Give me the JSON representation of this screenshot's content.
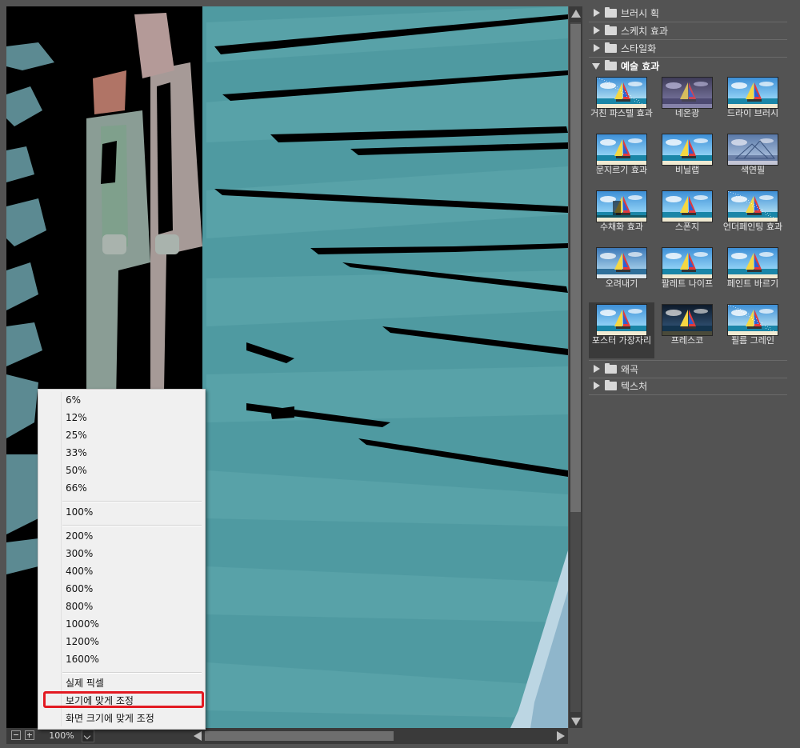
{
  "zoom_menu": {
    "items": [
      "6%",
      "12%",
      "25%",
      "33%",
      "50%",
      "66%",
      "100%",
      "200%",
      "300%",
      "400%",
      "600%",
      "800%",
      "1000%",
      "1200%",
      "1600%",
      "실제 픽셀",
      "보기에 맞게 조정",
      "화면 크기에 맞게 조정"
    ],
    "highlighted": "보기에 맞게 조정"
  },
  "statusbar": {
    "zoom_value": "100%"
  },
  "filter_panel": {
    "categories": [
      {
        "label": "브러시 획",
        "expanded": false
      },
      {
        "label": "스케치 효과",
        "expanded": false
      },
      {
        "label": "스타일화",
        "expanded": false
      },
      {
        "label": "예술 효과",
        "expanded": true
      },
      {
        "label": "왜곡",
        "expanded": false
      },
      {
        "label": "텍스처",
        "expanded": false
      }
    ],
    "artistic_filters": [
      {
        "label": "거친 파스텔 효과",
        "style": "pastel"
      },
      {
        "label": "네온광",
        "style": "neon"
      },
      {
        "label": "드라이 브러시",
        "style": "normal"
      },
      {
        "label": "문지르기 효과",
        "style": "normal"
      },
      {
        "label": "비닐랩",
        "style": "plastic"
      },
      {
        "label": "색연필",
        "style": "pencil"
      },
      {
        "label": "수채화 효과",
        "style": "watercolor"
      },
      {
        "label": "스폰지",
        "style": "normal"
      },
      {
        "label": "언더페인팅 효과",
        "style": "under"
      },
      {
        "label": "오려내기",
        "style": "cutout"
      },
      {
        "label": "팔레트 나이프",
        "style": "normal"
      },
      {
        "label": "페인트 바르기",
        "style": "normal"
      },
      {
        "label": "포스터 가장자리",
        "style": "poster",
        "selected": true
      },
      {
        "label": "프레스코",
        "style": "fresco"
      },
      {
        "label": "필름 그레인",
        "style": "grain"
      }
    ]
  },
  "colors": {
    "highlight_border": "#e31a22",
    "panel_bg": "#535353",
    "preview_teal": "#4f9aa1"
  }
}
